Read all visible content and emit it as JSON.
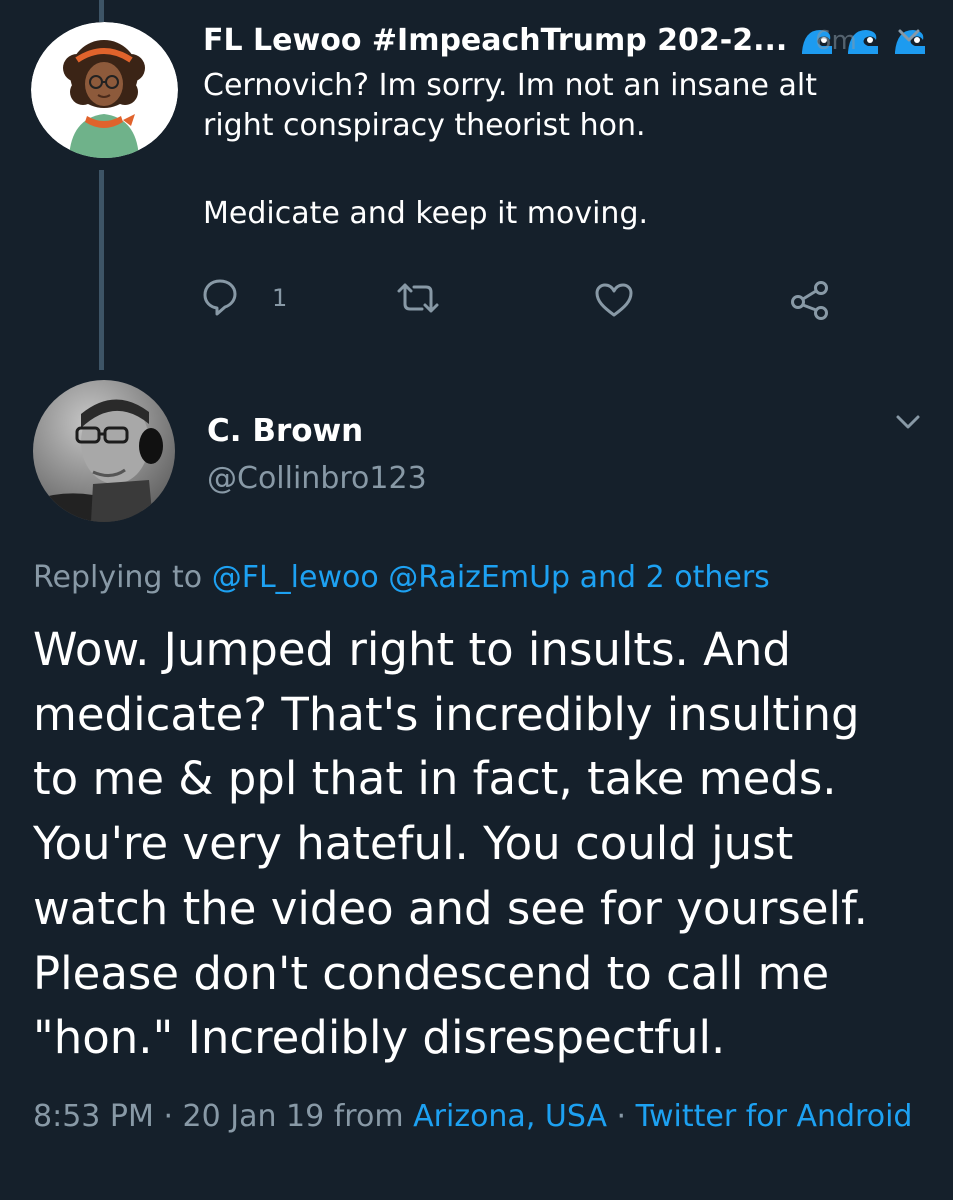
{
  "parent_tweet": {
    "display_name": "FL Lewoo #ImpeachTrump 202-2...",
    "time_overlay": "6m",
    "text_lines": [
      "Cernovich? Im sorry. Im not an insane alt",
      "right conspiracy theorist hon."
    ],
    "text_line_2": "Medicate and keep it moving.",
    "reply_count": "1"
  },
  "main_tweet": {
    "display_name": "C. Brown",
    "handle": "@Collinbro123",
    "replying_prefix": "Replying to",
    "replying_user1": "@FL_lewoo",
    "replying_user2": "@RaizEmUp",
    "replying_others": "and 2 others",
    "text_lines": [
      "Wow. Jumped right to insults. And",
      "medicate? That's incredibly insulting",
      "to me & ppl that in fact, take meds.",
      "You're very hateful. You could just",
      "watch the video and see for yourself.",
      "Please don't condescend to call me",
      "\"hon.\" Incredibly disrespectful."
    ],
    "time": "8:53 PM",
    "date": "20 Jan 19",
    "from_word": "from",
    "location": "Arizona, USA",
    "source": "Twitter for Android",
    "separator": "·"
  },
  "colors": {
    "background": "#15202b",
    "text_primary": "#ffffff",
    "text_secondary": "#8899a6",
    "link": "#1da1f2",
    "thread_line": "#3d5466"
  },
  "icons": {
    "reply": "reply-icon",
    "retweet": "retweet-icon",
    "like": "heart-icon",
    "share": "share-icon",
    "caret": "chevron-down-icon",
    "wave": "water-wave-emoji"
  }
}
